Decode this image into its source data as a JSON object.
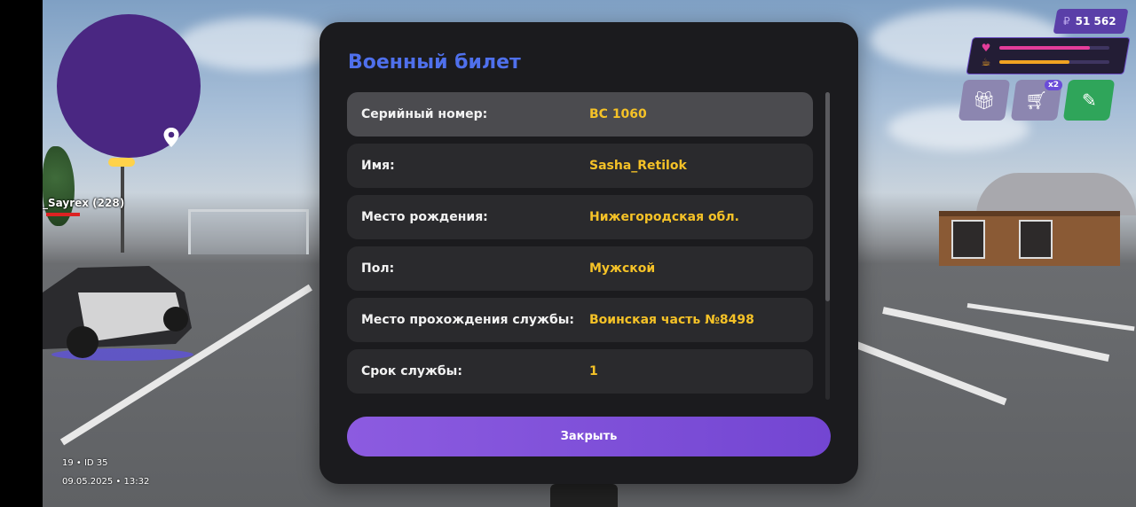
{
  "hud": {
    "money_currency": "₽",
    "money_value": "51 562",
    "shop_badge": "x2",
    "player_tag": "_Sayrex (228)",
    "bottom_line1": "19 • ID 35",
    "bottom_line2": "09.05.2025 • 13:32",
    "health_level": 0.82,
    "hunger_level": 0.64,
    "colors": {
      "health": "#e43d9a",
      "hunger": "#f0a322",
      "accent": "#6a4cd8"
    },
    "buttons": [
      {
        "icon": "gift-icon"
      },
      {
        "icon": "cart-icon"
      },
      {
        "icon": "syringe-icon"
      }
    ]
  },
  "dialog": {
    "title": "Военный билет",
    "rows": [
      {
        "label": "Серийный номер:",
        "value": "ВС 1060"
      },
      {
        "label": "Имя:",
        "value": "Sasha_Retilok"
      },
      {
        "label": "Место рождения:",
        "value": "Нижегородская обл."
      },
      {
        "label": "Пол:",
        "value": "Мужской"
      },
      {
        "label": "Место прохождения службы:",
        "value": "Воинская часть №8498"
      },
      {
        "label": "Срок службы:",
        "value": "1"
      }
    ],
    "close_label": "Закрыть",
    "colors": {
      "title": "#4f70ec",
      "value": "#f5c227"
    }
  }
}
